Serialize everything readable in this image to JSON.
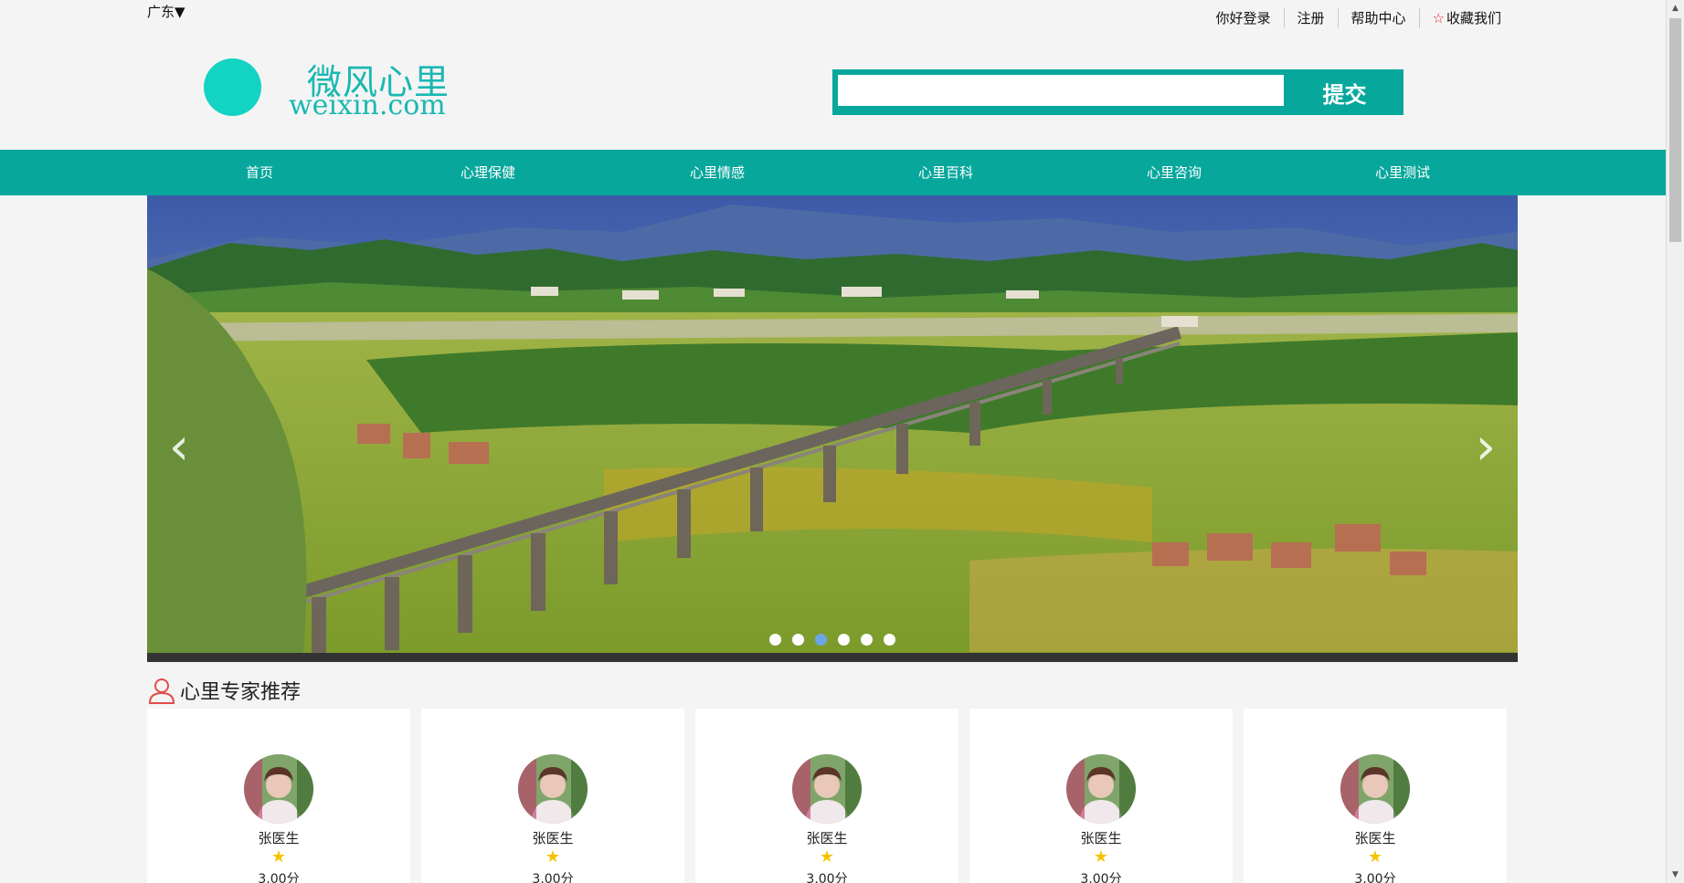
{
  "topbar": {
    "region": "广东▼",
    "links": [
      "你好登录",
      "注册",
      "帮助中心"
    ],
    "favorite_star": "☆",
    "favorite_label": "收藏我们"
  },
  "logo": {
    "title_cn": "微风心里",
    "domain": "weixin.com"
  },
  "search": {
    "placeholder": "",
    "value": "",
    "button_label": "提交"
  },
  "nav": {
    "items": [
      "首页",
      "心理保健",
      "心里情感",
      "心里百科",
      "心里咨询",
      "心里测试"
    ]
  },
  "banner": {
    "prev_arrow": "‹",
    "next_arrow": "›",
    "slide_count": 6,
    "active_slide": 3
  },
  "section": {
    "title": "心里专家推荐"
  },
  "doctors": [
    {
      "name": "张医生",
      "rating_star": "★",
      "score": "3.00分"
    },
    {
      "name": "张医生",
      "rating_star": "★",
      "score": "3.00分"
    },
    {
      "name": "张医生",
      "rating_star": "★",
      "score": "3.00分"
    },
    {
      "name": "张医生",
      "rating_star": "★",
      "score": "3.00分"
    },
    {
      "name": "张医生",
      "rating_star": "★",
      "score": "3.00分"
    }
  ],
  "colors": {
    "accent": "#08a79c",
    "logo": "#19b8b1",
    "logo_circle": "#13d3c3",
    "star": "#f5c400",
    "active_dot": "#6ca6e8"
  }
}
